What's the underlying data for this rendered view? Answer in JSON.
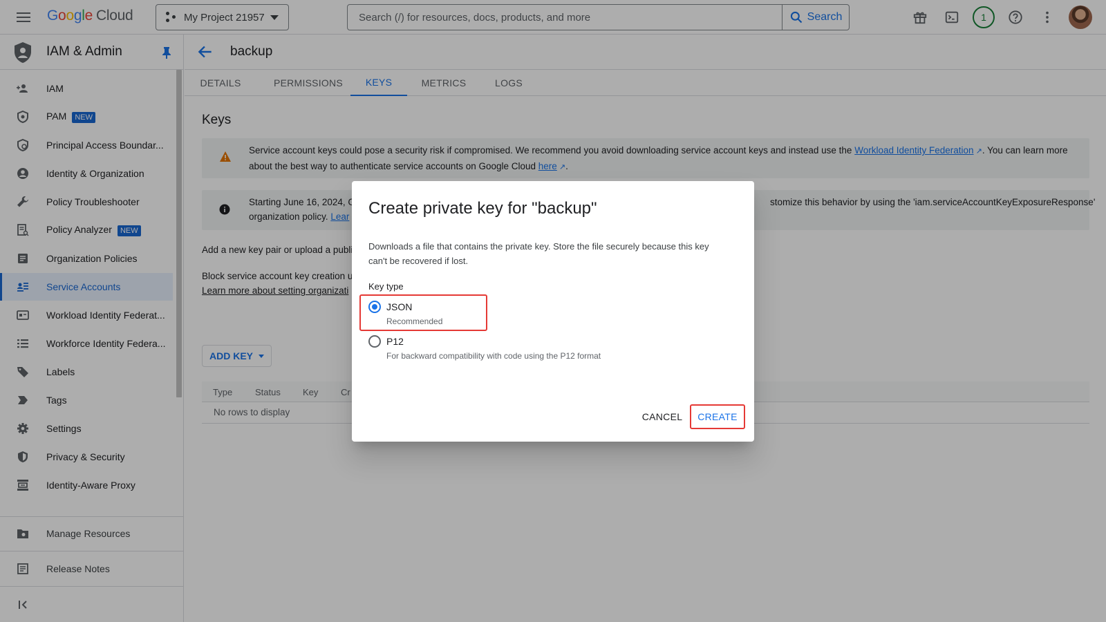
{
  "topbar": {
    "logo_google": "Google",
    "logo_cloud": "Cloud",
    "project_name": "My Project 21957",
    "search_placeholder": "Search (/) for resources, docs, products, and more",
    "search_button": "Search",
    "notification_count": "1"
  },
  "sidebar": {
    "title": "IAM & Admin",
    "items": [
      {
        "label": "IAM",
        "icon": "person-add-icon"
      },
      {
        "label": "PAM",
        "badge": "NEW",
        "icon": "shield-icon"
      },
      {
        "label": "Principal Access Boundar...",
        "icon": "boundary-icon"
      },
      {
        "label": "Identity & Organization",
        "icon": "account-circle-icon"
      },
      {
        "label": "Policy Troubleshooter",
        "icon": "wrench-icon"
      },
      {
        "label": "Policy Analyzer",
        "badge": "NEW",
        "icon": "document-search-icon"
      },
      {
        "label": "Organization Policies",
        "icon": "article-icon"
      },
      {
        "label": "Service Accounts",
        "icon": "service-account-icon",
        "active": true
      },
      {
        "label": "Workload Identity Federat...",
        "icon": "id-card-icon"
      },
      {
        "label": "Workforce Identity Federa...",
        "icon": "list-icon"
      },
      {
        "label": "Labels",
        "icon": "tag-icon"
      },
      {
        "label": "Tags",
        "icon": "label-arrow-icon"
      },
      {
        "label": "Settings",
        "icon": "gear-icon"
      },
      {
        "label": "Privacy & Security",
        "icon": "privacy-shield-icon"
      },
      {
        "label": "Identity-Aware Proxy",
        "icon": "proxy-icon"
      }
    ],
    "footer_items": [
      {
        "label": "Manage Resources",
        "icon": "folder-gear-icon"
      },
      {
        "label": "Release Notes",
        "icon": "notes-icon"
      }
    ]
  },
  "main": {
    "page_title": "backup",
    "tabs": [
      "DETAILS",
      "PERMISSIONS",
      "KEYS",
      "METRICS",
      "LOGS"
    ],
    "active_tab": "KEYS",
    "section_title": "Keys",
    "warning_banner": {
      "text_before": "Service account keys could pose a security risk if compromised. We recommend you avoid downloading service account keys and instead use the ",
      "link1": "Workload Identity Federation",
      "text_middle": ". You can learn more about the best way to authenticate service accounts on Google Cloud ",
      "link2": "here",
      "text_end": "."
    },
    "info_banner": {
      "text_left": "Starting June 16, 2024, G",
      "text_left2": "organization policy. ",
      "link": "Lear",
      "text_right": "stomize this behavior by using the 'iam.serviceAccountKeyExposureResponse'"
    },
    "add_key_text": "Add a new key pair or upload a publi",
    "block_text": "Block service account key creation u",
    "block_link": "Learn more about setting organizati",
    "add_key_button": "ADD KEY",
    "table": {
      "columns": [
        "Type",
        "Status",
        "Key",
        "Cr"
      ],
      "empty": "No rows to display"
    }
  },
  "dialog": {
    "title": "Create private key for \"backup\"",
    "description": "Downloads a file that contains the private key. Store the file securely because this key can't be recovered if lost.",
    "key_type_label": "Key type",
    "options": [
      {
        "label": "JSON",
        "sub": "Recommended",
        "checked": true
      },
      {
        "label": "P12",
        "sub": "For backward compatibility with code using the P12 format",
        "checked": false
      }
    ],
    "cancel": "CANCEL",
    "create": "CREATE"
  },
  "colors": {
    "accent": "#1a73e8",
    "highlight": "#e53935",
    "active_bg": "#e8f0fe"
  }
}
